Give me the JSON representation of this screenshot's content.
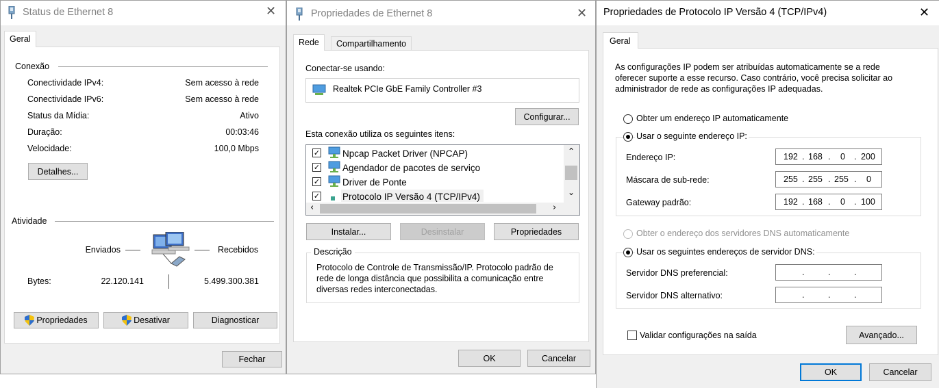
{
  "status_window": {
    "title": "Status de Ethernet 8",
    "tab": "Geral",
    "connection_section": "Conexão",
    "rows": [
      {
        "label": "Conectividade IPv4:",
        "value": "Sem acesso à rede"
      },
      {
        "label": "Conectividade IPv6:",
        "value": "Sem acesso à rede"
      },
      {
        "label": "Status da Mídia:",
        "value": "Ativo"
      },
      {
        "label": "Duração:",
        "value": "00:03:46"
      },
      {
        "label": "Velocidade:",
        "value": "100,0 Mbps"
      }
    ],
    "details_button": "Detalhes...",
    "activity_section": "Atividade",
    "sent_label": "Enviados",
    "received_label": "Recebidos",
    "bytes_label": "Bytes:",
    "bytes_sent": "22.120.141",
    "bytes_received": "5.499.300.381",
    "properties_button": "Propriedades",
    "disable_button": "Desativar",
    "diagnose_button": "Diagnosticar",
    "close_button": "Fechar"
  },
  "eth_props_window": {
    "title": "Propriedades de Ethernet 8",
    "tabs": [
      "Rede",
      "Compartilhamento"
    ],
    "connect_using_label": "Conectar-se usando:",
    "adapter_name": "Realtek PCIe GbE Family Controller #3",
    "configure_button": "Configurar...",
    "items_label": "Esta conexão utiliza os seguintes itens:",
    "items": [
      {
        "label": "Npcap Packet Driver (NPCAP)",
        "checked": true
      },
      {
        "label": "Agendador de pacotes de serviço",
        "checked": true
      },
      {
        "label": "Driver de Ponte",
        "checked": true
      },
      {
        "label": "Protocolo IP Versão 4 (TCP/IPv4)",
        "checked": true
      }
    ],
    "install_button": "Instalar...",
    "uninstall_button": "Desinstalar",
    "properties_button": "Propriedades",
    "description_label": "Descrição",
    "description_text": "Protocolo de Controle de Transmissão/IP. Protocolo padrão de rede de longa distância que possibilita a comunicação entre diversas redes interconectadas.",
    "ok_button": "OK",
    "cancel_button": "Cancelar"
  },
  "ipv4_window": {
    "title": "Propriedades de Protocolo IP Versão 4 (TCP/IPv4)",
    "tab": "Geral",
    "intro": "As configurações IP podem ser atribuídas automaticamente se a rede oferecer suporte a esse recurso. Caso contrário, você precisa solicitar ao administrador de rede as configurações IP adequadas.",
    "auto_ip_radio": "Obter um endereço IP automaticamente",
    "manual_ip_radio": "Usar o seguinte endereço IP:",
    "ip_label": "Endereço IP:",
    "ip_octets": [
      "192",
      "168",
      "0",
      "200"
    ],
    "mask_label": "Máscara de sub-rede:",
    "mask_octets": [
      "255",
      "255",
      "255",
      "0"
    ],
    "gateway_label": "Gateway padrão:",
    "gateway_octets": [
      "192",
      "168",
      "0",
      "100"
    ],
    "auto_dns_radio": "Obter o endereço dos servidores DNS automaticamente",
    "manual_dns_radio": "Usar os seguintes endereços de servidor DNS:",
    "dns_pref_label": "Servidor DNS preferencial:",
    "dns_alt_label": "Servidor DNS alternativo:",
    "validate_checkbox": "Validar configurações na saída",
    "advanced_button": "Avançado...",
    "ok_button": "OK",
    "cancel_button": "Cancelar"
  },
  "colors": {
    "dialog_bg": "#f0f0f0",
    "accent": "#0078d7",
    "button_bg": "#e1e1e1"
  }
}
